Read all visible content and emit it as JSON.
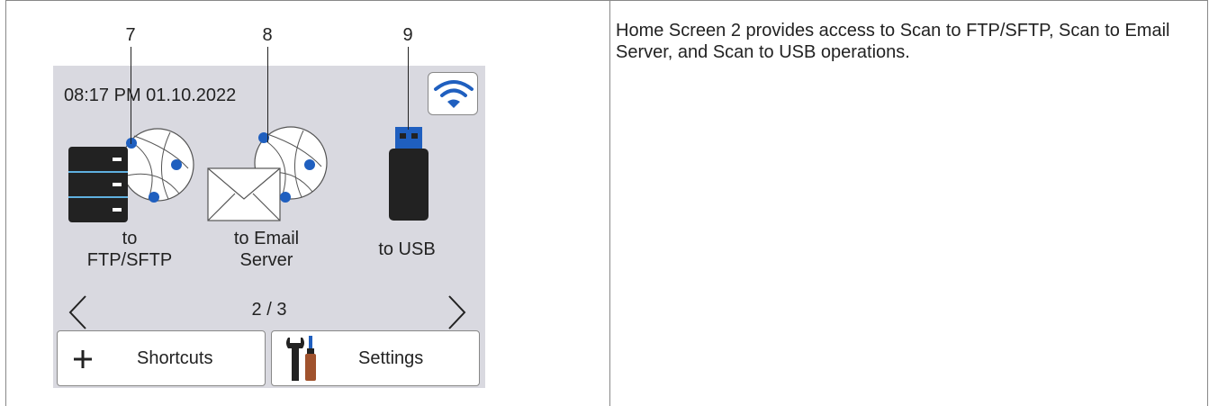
{
  "callouts": [
    "7",
    "8",
    "9"
  ],
  "screen": {
    "datetime": "08:17 PM 01.10.2022",
    "apps": [
      {
        "label_line1": "to",
        "label_line2": "FTP/SFTP",
        "icon": "server-globe-icon"
      },
      {
        "label_line1": "to Email",
        "label_line2": "Server",
        "icon": "email-globe-icon"
      },
      {
        "label_line1": "to USB",
        "icon": "usb-drive-icon"
      }
    ],
    "page_indicator": "2  /  3",
    "shortcuts_label": "Shortcuts",
    "settings_label": "Settings"
  },
  "description": "Home Screen 2 provides access to Scan to FTP/SFTP, Scan to Email Server, and Scan to USB operations.",
  "colors": {
    "screen_bg": "#d9d9e0",
    "accent_blue": "#1f5fbf",
    "icon_dark": "#222222"
  }
}
